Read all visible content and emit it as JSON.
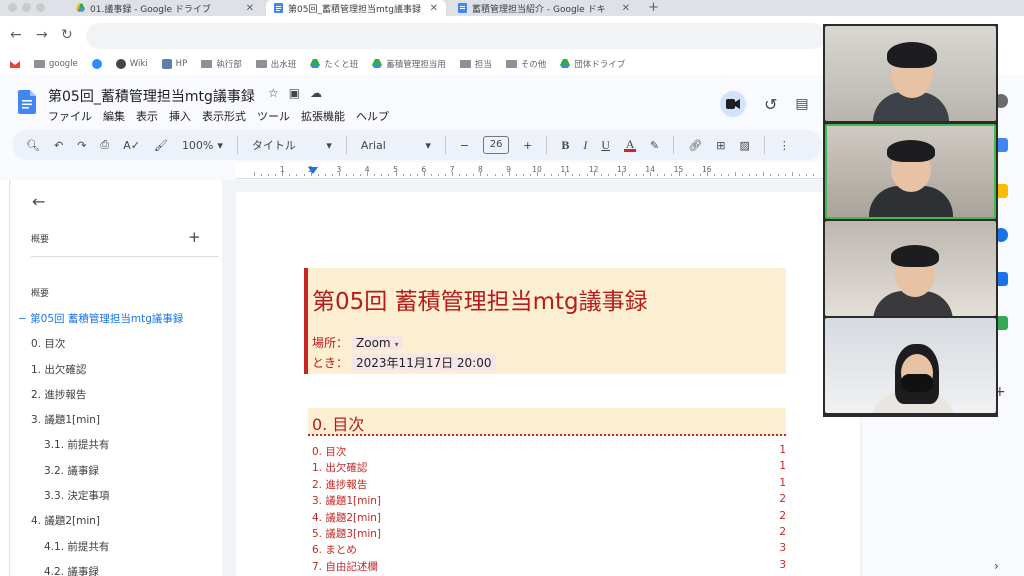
{
  "browser": {
    "tabs": [
      {
        "title": "01.議事録 - Google ドライブ",
        "icon": "google-drive-icon",
        "active": false
      },
      {
        "title": "第05回_蓄積管理担当mtg議事録",
        "icon": "google-docs-icon",
        "active": true
      },
      {
        "title": "蓄積管理担当紹介 - Google ドキ",
        "icon": "google-docs-icon",
        "active": false
      }
    ],
    "new_tab": "+",
    "bookmarks": [
      {
        "label": "",
        "icon": "gmail-icon"
      },
      {
        "label": "google",
        "icon": "folder-icon"
      },
      {
        "label": "",
        "icon": "zoom-icon"
      },
      {
        "label": "Wiki",
        "icon": "wikipedia-icon"
      },
      {
        "label": "HP",
        "icon": "site-icon"
      },
      {
        "label": "執行部",
        "icon": "folder-icon"
      },
      {
        "label": "出水班",
        "icon": "folder-icon"
      },
      {
        "label": "たくと班",
        "icon": "google-drive-icon"
      },
      {
        "label": "蓄積管理担当用",
        "icon": "google-drive-icon"
      },
      {
        "label": "担当",
        "icon": "folder-icon"
      },
      {
        "label": "その他",
        "icon": "folder-icon"
      },
      {
        "label": "団体ドライブ",
        "icon": "google-drive-icon"
      }
    ]
  },
  "doc": {
    "title": "第05回_蓄積管理担当mtg議事録",
    "menu": [
      "ファイル",
      "編集",
      "表示",
      "挿入",
      "表示形式",
      "ツール",
      "拡張機能",
      "ヘルプ"
    ]
  },
  "toolbar": {
    "zoom": "100%",
    "style": "タイトル",
    "font": "Arial",
    "font_size": "26",
    "minus": "−",
    "plus": "+",
    "bold": "B",
    "italic": "I",
    "underline": "U",
    "text_color": "A"
  },
  "ruler": {
    "numbers": [
      "1",
      "2",
      "3",
      "4",
      "5",
      "6",
      "7",
      "8",
      "9",
      "10",
      "11",
      "12",
      "13",
      "14",
      "15",
      "16"
    ]
  },
  "outline_panel": {
    "summary_label": "概要",
    "add": "+",
    "outline_label": "概要",
    "items": [
      {
        "text": "第05回 蓄積管理担当mtg議事録",
        "level": 1
      },
      {
        "text": "0. 目次",
        "level": 2
      },
      {
        "text": "1. 出欠確認",
        "level": 2
      },
      {
        "text": "2. 進捗報告",
        "level": 2
      },
      {
        "text": "3. 議題1[min]",
        "level": 2
      },
      {
        "text": "3.1. 前提共有",
        "level": 3
      },
      {
        "text": "3.2. 議事録",
        "level": 3
      },
      {
        "text": "3.3. 決定事項",
        "level": 3
      },
      {
        "text": "4. 議題2[min]",
        "level": 2
      },
      {
        "text": "4.1. 前提共有",
        "level": 3
      },
      {
        "text": "4.2. 議事録",
        "level": 3
      }
    ]
  },
  "document": {
    "heading": "第05回 蓄積管理担当mtg議事録",
    "place_label": "場所：",
    "place_value": "Zoom",
    "time_label": "とき：",
    "time_value": "2023年11月17日 20:00",
    "section0": "0.  目次",
    "toc": [
      {
        "text": "0.  目次",
        "page": "1"
      },
      {
        "text": "1.  出欠確認",
        "page": "1"
      },
      {
        "text": "2.  進捗報告",
        "page": "1"
      },
      {
        "text": "3.  議題1[min]",
        "page": "2"
      },
      {
        "text": "4.  議題2[min]",
        "page": "2"
      },
      {
        "text": "5.  議題3[min]",
        "page": "2"
      },
      {
        "text": "6.  まとめ",
        "page": "3"
      },
      {
        "text": "7.  自由記述欄",
        "page": "3"
      }
    ]
  },
  "colors": {
    "accent_red": "#c62828",
    "title_bg": "#fdefd2",
    "link_blue": "#1a73e8",
    "active_speaker": "#3fb950"
  }
}
